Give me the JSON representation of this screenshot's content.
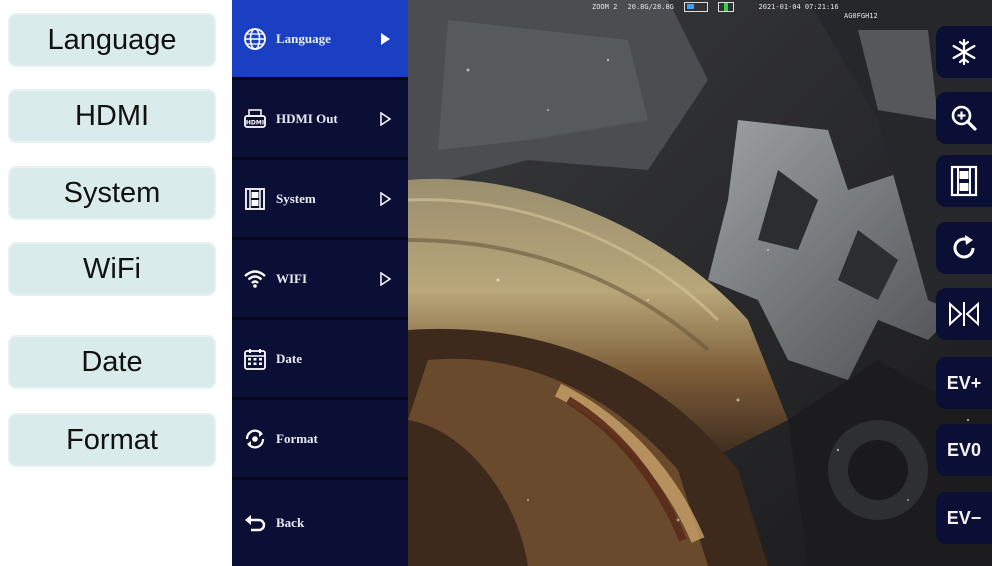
{
  "legend": [
    {
      "label": "Language"
    },
    {
      "label": "HDMI"
    },
    {
      "label": "System"
    },
    {
      "label": "WiFi"
    },
    {
      "label": "Date"
    },
    {
      "label": "Format"
    }
  ],
  "menu": {
    "items": [
      {
        "label": "Language",
        "icon": "globe-icon",
        "has_arrow": true,
        "active": true
      },
      {
        "label": "HDMI Out",
        "icon": "hdmi-icon",
        "has_arrow": true
      },
      {
        "label": "System",
        "icon": "film-icon",
        "has_arrow": true
      },
      {
        "label": "WIFI",
        "icon": "wifi-icon",
        "has_arrow": true
      },
      {
        "label": "Date",
        "icon": "calendar-icon",
        "has_arrow": false
      },
      {
        "label": "Format",
        "icon": "format-icon",
        "has_arrow": false
      },
      {
        "label": "Back",
        "icon": "back-icon",
        "has_arrow": false
      }
    ]
  },
  "status": {
    "zoom": "ZOOM 2",
    "storage": "20.8G/28.8G",
    "datetime": "2021-01-04 07:21:16",
    "device_id": "AG0FGH12"
  },
  "toolbar": {
    "freeze_icon": "snowflake-icon",
    "zoom_icon": "zoom-in-icon",
    "video_icon": "film-icon",
    "rotate_icon": "rotate-icon",
    "mirror_icon": "mirror-icon",
    "ev_plus": "EV+",
    "ev_zero": "EV0",
    "ev_minus": "EV−"
  },
  "colors": {
    "menu_bg": "#0b0f35",
    "menu_active": "#1a3fc3",
    "legend_bg": "#d9ebeb"
  }
}
